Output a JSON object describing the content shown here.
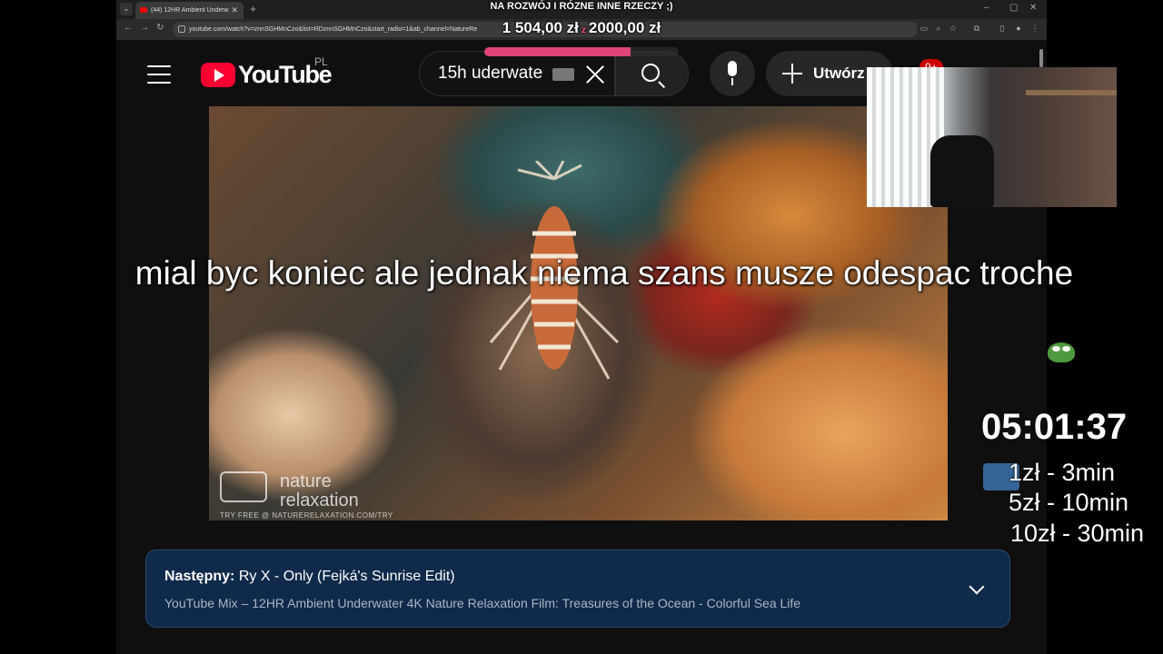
{
  "browser": {
    "tab_title": "(44) 12HR Ambient Underw",
    "url": "youtube.com/watch?v=znnSGHMnCzo&list=RDznnSGHMnCzo&start_radio=1&ab_channel=NatureRe"
  },
  "stream": {
    "goal_title": "NA ROZWÓJ I RÓZNE INNE RZECZY ;)",
    "goal_current": "1 504,00 zł",
    "goal_target": "2000,00 zł",
    "goal_progress": 0.752,
    "caption": "mial byc koniec ale jednak niema szans musze odespac troche",
    "timer": "05:01:37",
    "prices": [
      "1zł - 3min",
      "5zł - 10min",
      "10zł - 30min"
    ]
  },
  "youtube": {
    "logo_text": "YouTube",
    "country_code": "PL",
    "search_value": "15h uderwate",
    "create_label": "Utwórz",
    "notification_badge": "9+",
    "video": {
      "watermark_line1": "nature",
      "watermark_line2": "relaxation",
      "watermark_url": "TRY FREE @ NATURERELAXATION.COM/TRY"
    },
    "up_next": {
      "label": "Następny:",
      "title": "Ry X - Only (Fejká's Sunrise Edit)",
      "subtitle": "YouTube Mix – 12HR Ambient Underwater 4K Nature Relaxation Film: Treasures of the Ocean - Colorful Sea Life"
    }
  },
  "colors": {
    "youtube_red": "#ff0033",
    "up_next_bg": "#0f2a4a",
    "goal_fill": "#e0457a"
  }
}
